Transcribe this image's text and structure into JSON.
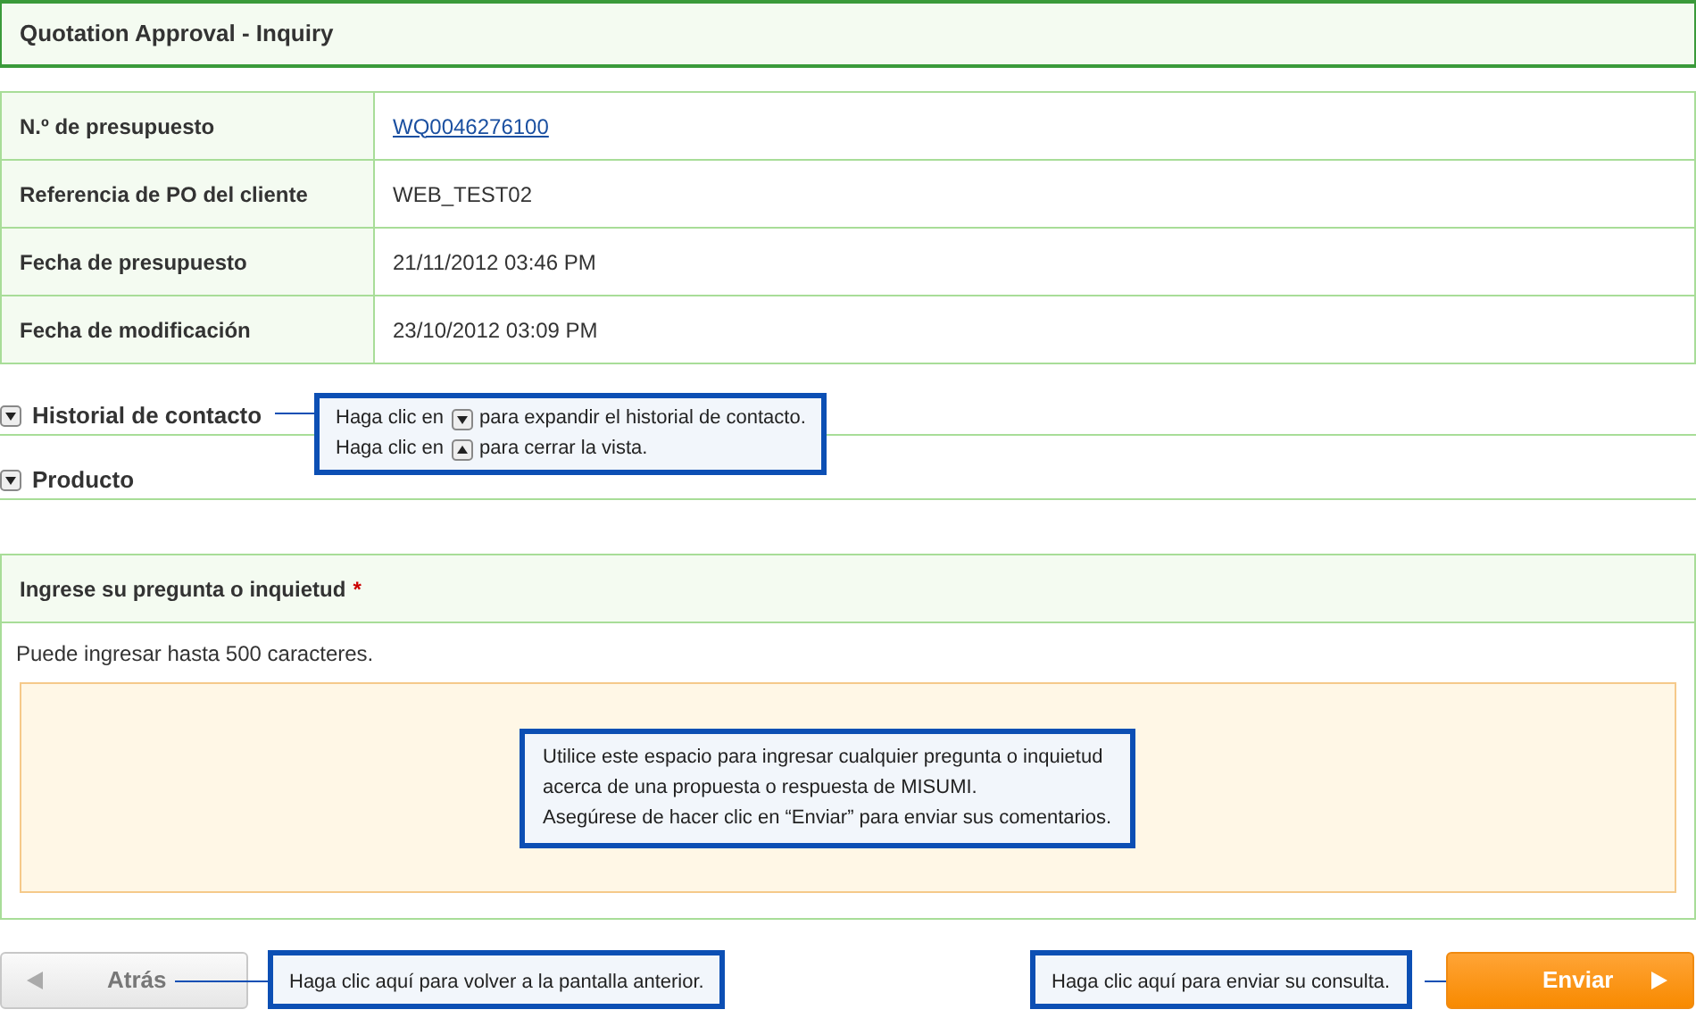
{
  "header": {
    "title": "Quotation Approval - Inquiry"
  },
  "details": [
    {
      "label": "N.º de presupuesto",
      "value": "WQ0046276100",
      "kind": "link"
    },
    {
      "label": "Referencia de PO del cliente",
      "value": "WEB_TEST02",
      "kind": "text"
    },
    {
      "label": "Fecha de presupuesto",
      "value": "21/11/2012 03:46 PM",
      "kind": "text"
    },
    {
      "label": "Fecha de modificación",
      "value": "23/10/2012 03:09 PM",
      "kind": "text"
    }
  ],
  "sections": [
    {
      "title": "Historial de contacto",
      "expanded": false
    },
    {
      "title": "Producto",
      "expanded": false
    }
  ],
  "inquiry": {
    "title": "Ingrese su pregunta o inquietud",
    "required_mark": "*",
    "hint": "Puede ingresar hasta 500 caracteres."
  },
  "callouts": {
    "sections": [
      {
        "before": "Haga clic en",
        "kind": "down",
        "after": "para expandir el historial de contacto."
      },
      {
        "before": "Haga clic en",
        "kind": "up",
        "after": "para cerrar la vista."
      }
    ],
    "inquiry": [
      "Utilice este espacio para ingresar cualquier pregunta o inquietud",
      "acerca de una propuesta o respuesta de MISUMI.",
      "Asegúrese de hacer clic en “Enviar” para enviar sus comentarios."
    ],
    "back": "Haga clic aquí para volver a la pantalla anterior.",
    "send": "Haga clic aquí para enviar su consulta."
  },
  "buttons": {
    "back": "Atrás",
    "send": "Enviar"
  }
}
